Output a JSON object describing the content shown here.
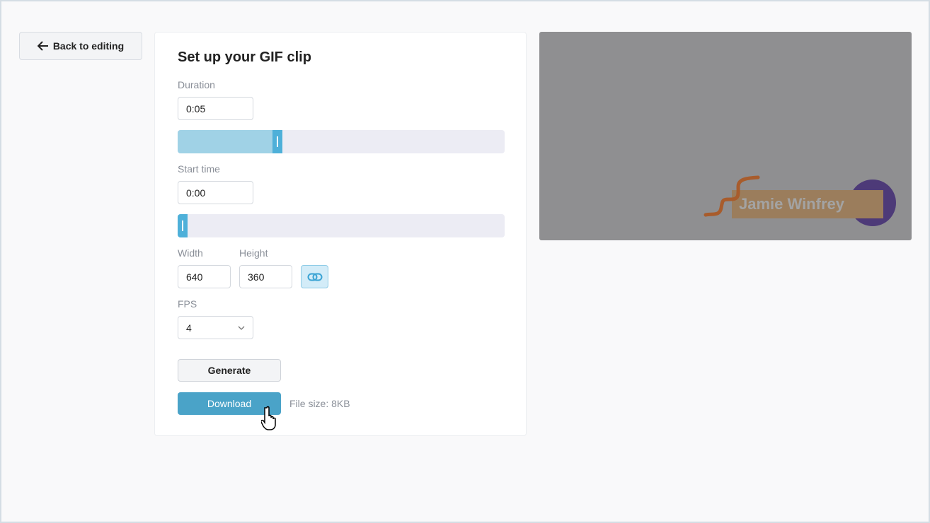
{
  "back_label": "Back to editing",
  "title": "Set up your GIF clip",
  "duration": {
    "label": "Duration",
    "value": "0:05",
    "slider_fraction": 0.3
  },
  "start": {
    "label": "Start time",
    "value": "0:00",
    "slider_fraction": 0.0
  },
  "width": {
    "label": "Width",
    "value": "640"
  },
  "height": {
    "label": "Height",
    "value": "360"
  },
  "fps": {
    "label": "FPS",
    "value": "4"
  },
  "generate_label": "Generate",
  "download_label": "Download",
  "file_size": "File size: 8KB",
  "preview": {
    "name_text": "Jamie Winfrey"
  },
  "colors": {
    "accent": "#4aa3c8",
    "slider_handle": "#4eb0d9"
  }
}
